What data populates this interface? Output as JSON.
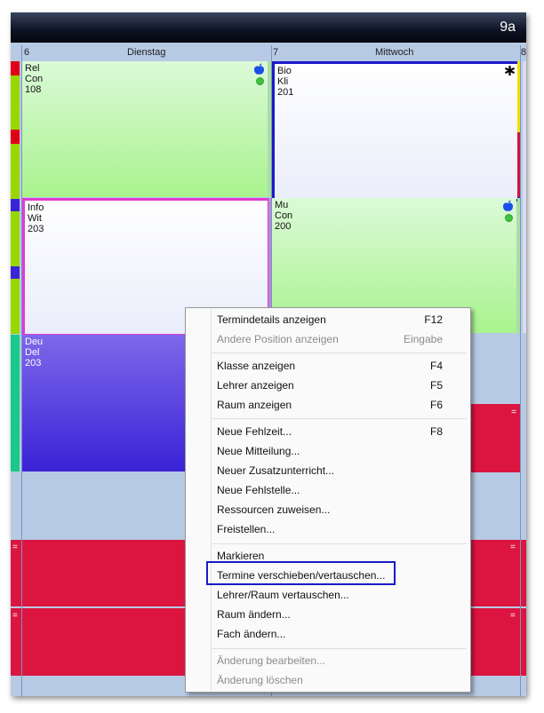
{
  "window": {
    "title": "9a"
  },
  "days": [
    {
      "num": "6",
      "name": "Dienstag"
    },
    {
      "num": "7",
      "name": "Mittwoch"
    },
    {
      "num": "8",
      "name": ""
    }
  ],
  "lessons": [
    {
      "subject": "Rel",
      "teacher": "Con",
      "room": "108"
    },
    {
      "subject": "Bio",
      "teacher": "Kli",
      "room": "201"
    },
    {
      "subject": "Info",
      "teacher": "Wit",
      "room": "203"
    },
    {
      "subject": "Mu",
      "teacher": "Con",
      "room": "200"
    },
    {
      "subject": "Deu",
      "teacher": "Del",
      "room": "203"
    }
  ],
  "marker": "=",
  "colors": {
    "accent_blue": "#1a1ac8",
    "magenta": "#e23ad4",
    "cancel_red": "#dc1540",
    "purple": "#4a30dc"
  },
  "menu": {
    "items": [
      {
        "label": "Termindetails anzeigen",
        "key": "F12",
        "disabled": false
      },
      {
        "label": "Andere Position anzeigen",
        "key": "Eingabe",
        "disabled": true
      },
      {
        "label": "Klasse anzeigen",
        "key": "F4",
        "disabled": false
      },
      {
        "label": "Lehrer anzeigen",
        "key": "F5",
        "disabled": false
      },
      {
        "label": "Raum anzeigen",
        "key": "F6",
        "disabled": false
      },
      {
        "label": "Neue Fehlzeit...",
        "key": "F8",
        "disabled": false
      },
      {
        "label": "Neue Mitteilung...",
        "key": "",
        "disabled": false
      },
      {
        "label": "Neuer Zusatzunterricht...",
        "key": "",
        "disabled": false
      },
      {
        "label": "Neue Fehlstelle...",
        "key": "",
        "disabled": false
      },
      {
        "label": "Ressourcen zuweisen...",
        "key": "",
        "disabled": false
      },
      {
        "label": "Freistellen...",
        "key": "",
        "disabled": false
      },
      {
        "label": "Markieren",
        "key": "",
        "disabled": false
      },
      {
        "label": "Termine verschieben/vertauschen...",
        "key": "",
        "disabled": false
      },
      {
        "label": "Lehrer/Raum vertauschen...",
        "key": "",
        "disabled": false
      },
      {
        "label": "Raum ändern...",
        "key": "",
        "disabled": false
      },
      {
        "label": "Fach ändern...",
        "key": "",
        "disabled": false
      },
      {
        "label": "Änderung bearbeiten...",
        "key": "",
        "disabled": true
      },
      {
        "label": "Änderung löschen",
        "key": "",
        "disabled": true
      }
    ]
  }
}
